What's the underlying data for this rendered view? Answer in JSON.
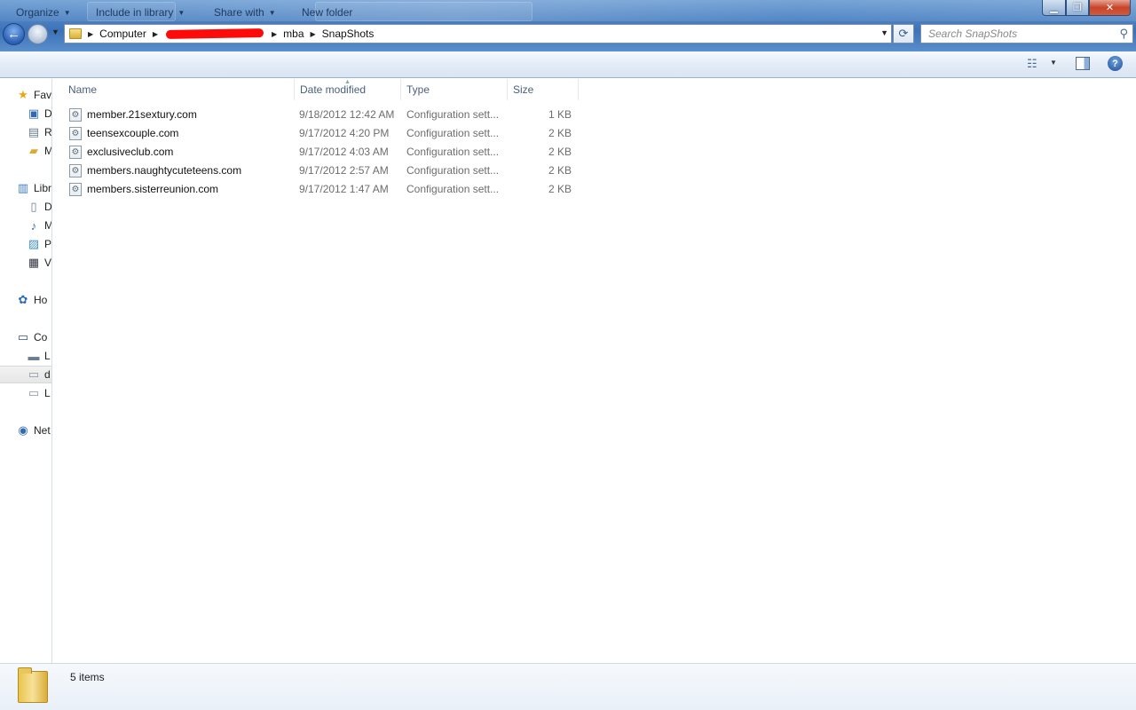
{
  "window": {
    "minimize_glyph": "▁",
    "maximize_glyph": "❐",
    "close_glyph": "✕"
  },
  "address": {
    "segments": [
      "Computer",
      "mba",
      "SnapShots"
    ],
    "dropdown_glyph": "▼"
  },
  "search": {
    "placeholder": "Search SnapShots"
  },
  "toolbar": {
    "organize": "Organize",
    "include_in_library": "Include in library",
    "share_with": "Share with",
    "new_folder": "New folder"
  },
  "navigation": {
    "items": [
      {
        "label": "Fav",
        "icon": "star-icon"
      },
      {
        "label": "D",
        "icon": "desktop-folder-icon"
      },
      {
        "label": "R",
        "icon": "recent-places-icon"
      },
      {
        "label": "M",
        "icon": "folder-icon"
      },
      {
        "label": "Libr",
        "icon": "libraries-icon"
      },
      {
        "label": "D",
        "icon": "documents-icon"
      },
      {
        "label": "M",
        "icon": "music-icon"
      },
      {
        "label": "P",
        "icon": "pictures-icon"
      },
      {
        "label": "V",
        "icon": "videos-icon"
      },
      {
        "label": "Ho",
        "icon": "homegroup-icon"
      },
      {
        "label": "Co",
        "icon": "computer-icon"
      },
      {
        "label": "L",
        "icon": "local-disk-icon"
      },
      {
        "label": "d",
        "icon": "drive-icon"
      },
      {
        "label": "L",
        "icon": "drive-icon"
      },
      {
        "label": "Net",
        "icon": "network-icon"
      }
    ]
  },
  "columns": {
    "name": "Name",
    "date_modified": "Date modified",
    "type": "Type",
    "size": "Size"
  },
  "files": [
    {
      "name": "member.21sextury.com",
      "date": "9/18/2012 12:42 AM",
      "type": "Configuration sett...",
      "size": "1 KB"
    },
    {
      "name": "teensexcouple.com",
      "date": "9/17/2012 4:20 PM",
      "type": "Configuration sett...",
      "size": "2 KB"
    },
    {
      "name": "exclusiveclub.com",
      "date": "9/17/2012 4:03 AM",
      "type": "Configuration sett...",
      "size": "2 KB"
    },
    {
      "name": "members.naughtycuteteens.com",
      "date": "9/17/2012 2:57 AM",
      "type": "Configuration sett...",
      "size": "2 KB"
    },
    {
      "name": "members.sisterreunion.com",
      "date": "9/17/2012 1:47 AM",
      "type": "Configuration sett...",
      "size": "2 KB"
    }
  ],
  "status": {
    "item_count": "5 items"
  },
  "colors": {
    "titlebar": "#4f84c4",
    "toolbar_text": "#1e3a5f",
    "redaction": "#ff0a0a"
  }
}
